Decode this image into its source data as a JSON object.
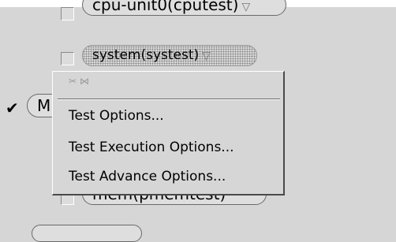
{
  "rows": {
    "row1_label": "cpu-unit0(cputest)",
    "row2_label": "system(systest)",
    "row3_label": "M",
    "row4_label": "mem(pmemtest)"
  },
  "glyphs": {
    "menu_arrow": "▽",
    "check": "✔"
  },
  "menu": {
    "title": "✂ ⋈",
    "items": [
      "Test Options...",
      "Test Execution Options...",
      "Test Advance Options..."
    ]
  },
  "colors": {
    "background": "#d6d6d6",
    "menu_shadow": "#4a4a4a"
  }
}
